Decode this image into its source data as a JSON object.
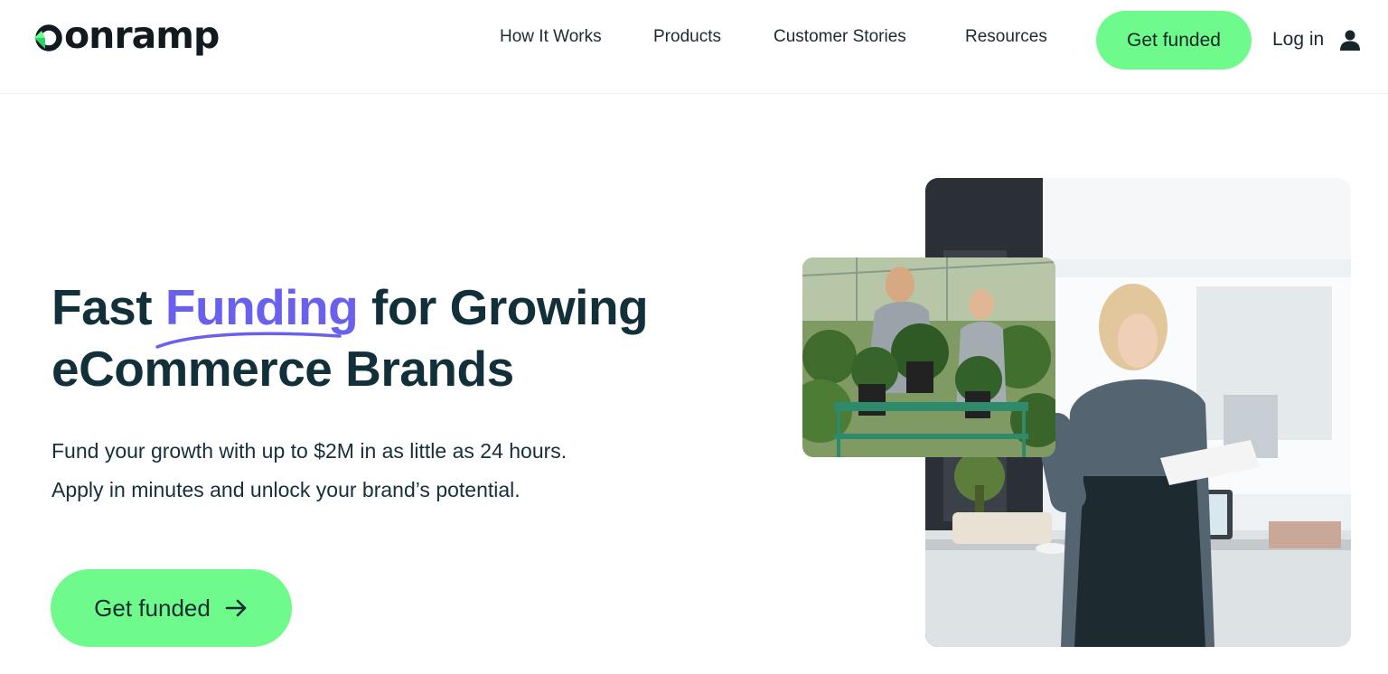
{
  "brand": {
    "name": "onramp",
    "accent": "#6efb8c",
    "highlight": "#6a60ee"
  },
  "nav": {
    "items": [
      "How It Works",
      "Products",
      "Customer Stories",
      "Resources"
    ],
    "cta": "Get funded",
    "login": "Log in"
  },
  "hero": {
    "title_part1": "Fast ",
    "title_highlight": "Funding",
    "title_part2": " for Growing",
    "title_line2": "eCommerce Brands",
    "subtitle_line1": "Fund your growth with up to $2M in as little as 24 hours.",
    "subtitle_line2": "Apply in minutes and unlock your brand’s potential.",
    "cta": "Get funded"
  },
  "icons": {
    "logo": "onramp-logo-mark",
    "user": "user-icon",
    "arrow": "arrow-right-icon"
  }
}
